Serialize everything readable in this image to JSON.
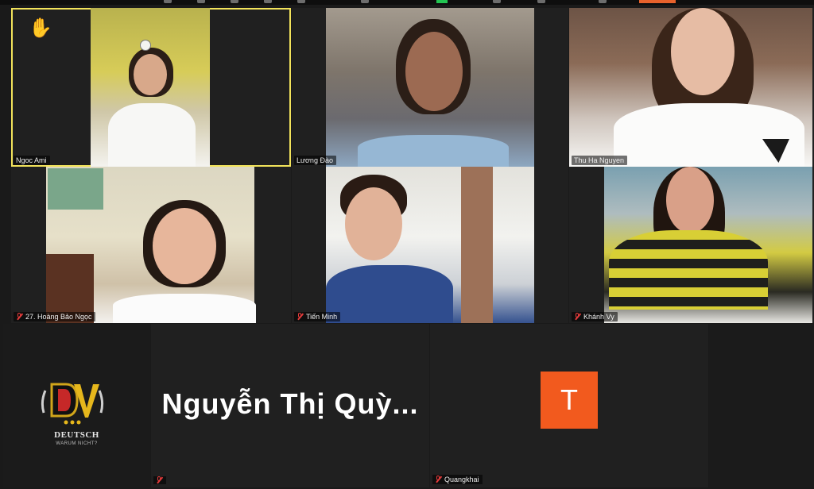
{
  "participants": [
    {
      "name": "Ngoc Ami",
      "muted": false,
      "active_speaker": true,
      "hand_raised": true
    },
    {
      "name": "Lương Đào",
      "muted": false
    },
    {
      "name": "Thu Ha Nguyen",
      "muted": false
    },
    {
      "name": "27. Hoàng Bảo Ngọc",
      "muted": true
    },
    {
      "name": "Tiến Minh",
      "muted": true
    },
    {
      "name": "Khánh Vy",
      "muted": true
    },
    {
      "name": "Nguyễn Thị Quỳ...",
      "muted": true,
      "video_off": true
    },
    {
      "name": "Quangkhai",
      "muted": true,
      "video_off": true,
      "avatar_initial": "T"
    }
  ],
  "logo": {
    "letters": "DV",
    "line1": "DEUTSCH",
    "line2": "WARUM NICHT?"
  },
  "colors": {
    "background": "#1a1a1a",
    "active_outline": "#f2e35b",
    "avatar": "#f25a1e",
    "muted": "#e33b3b"
  }
}
